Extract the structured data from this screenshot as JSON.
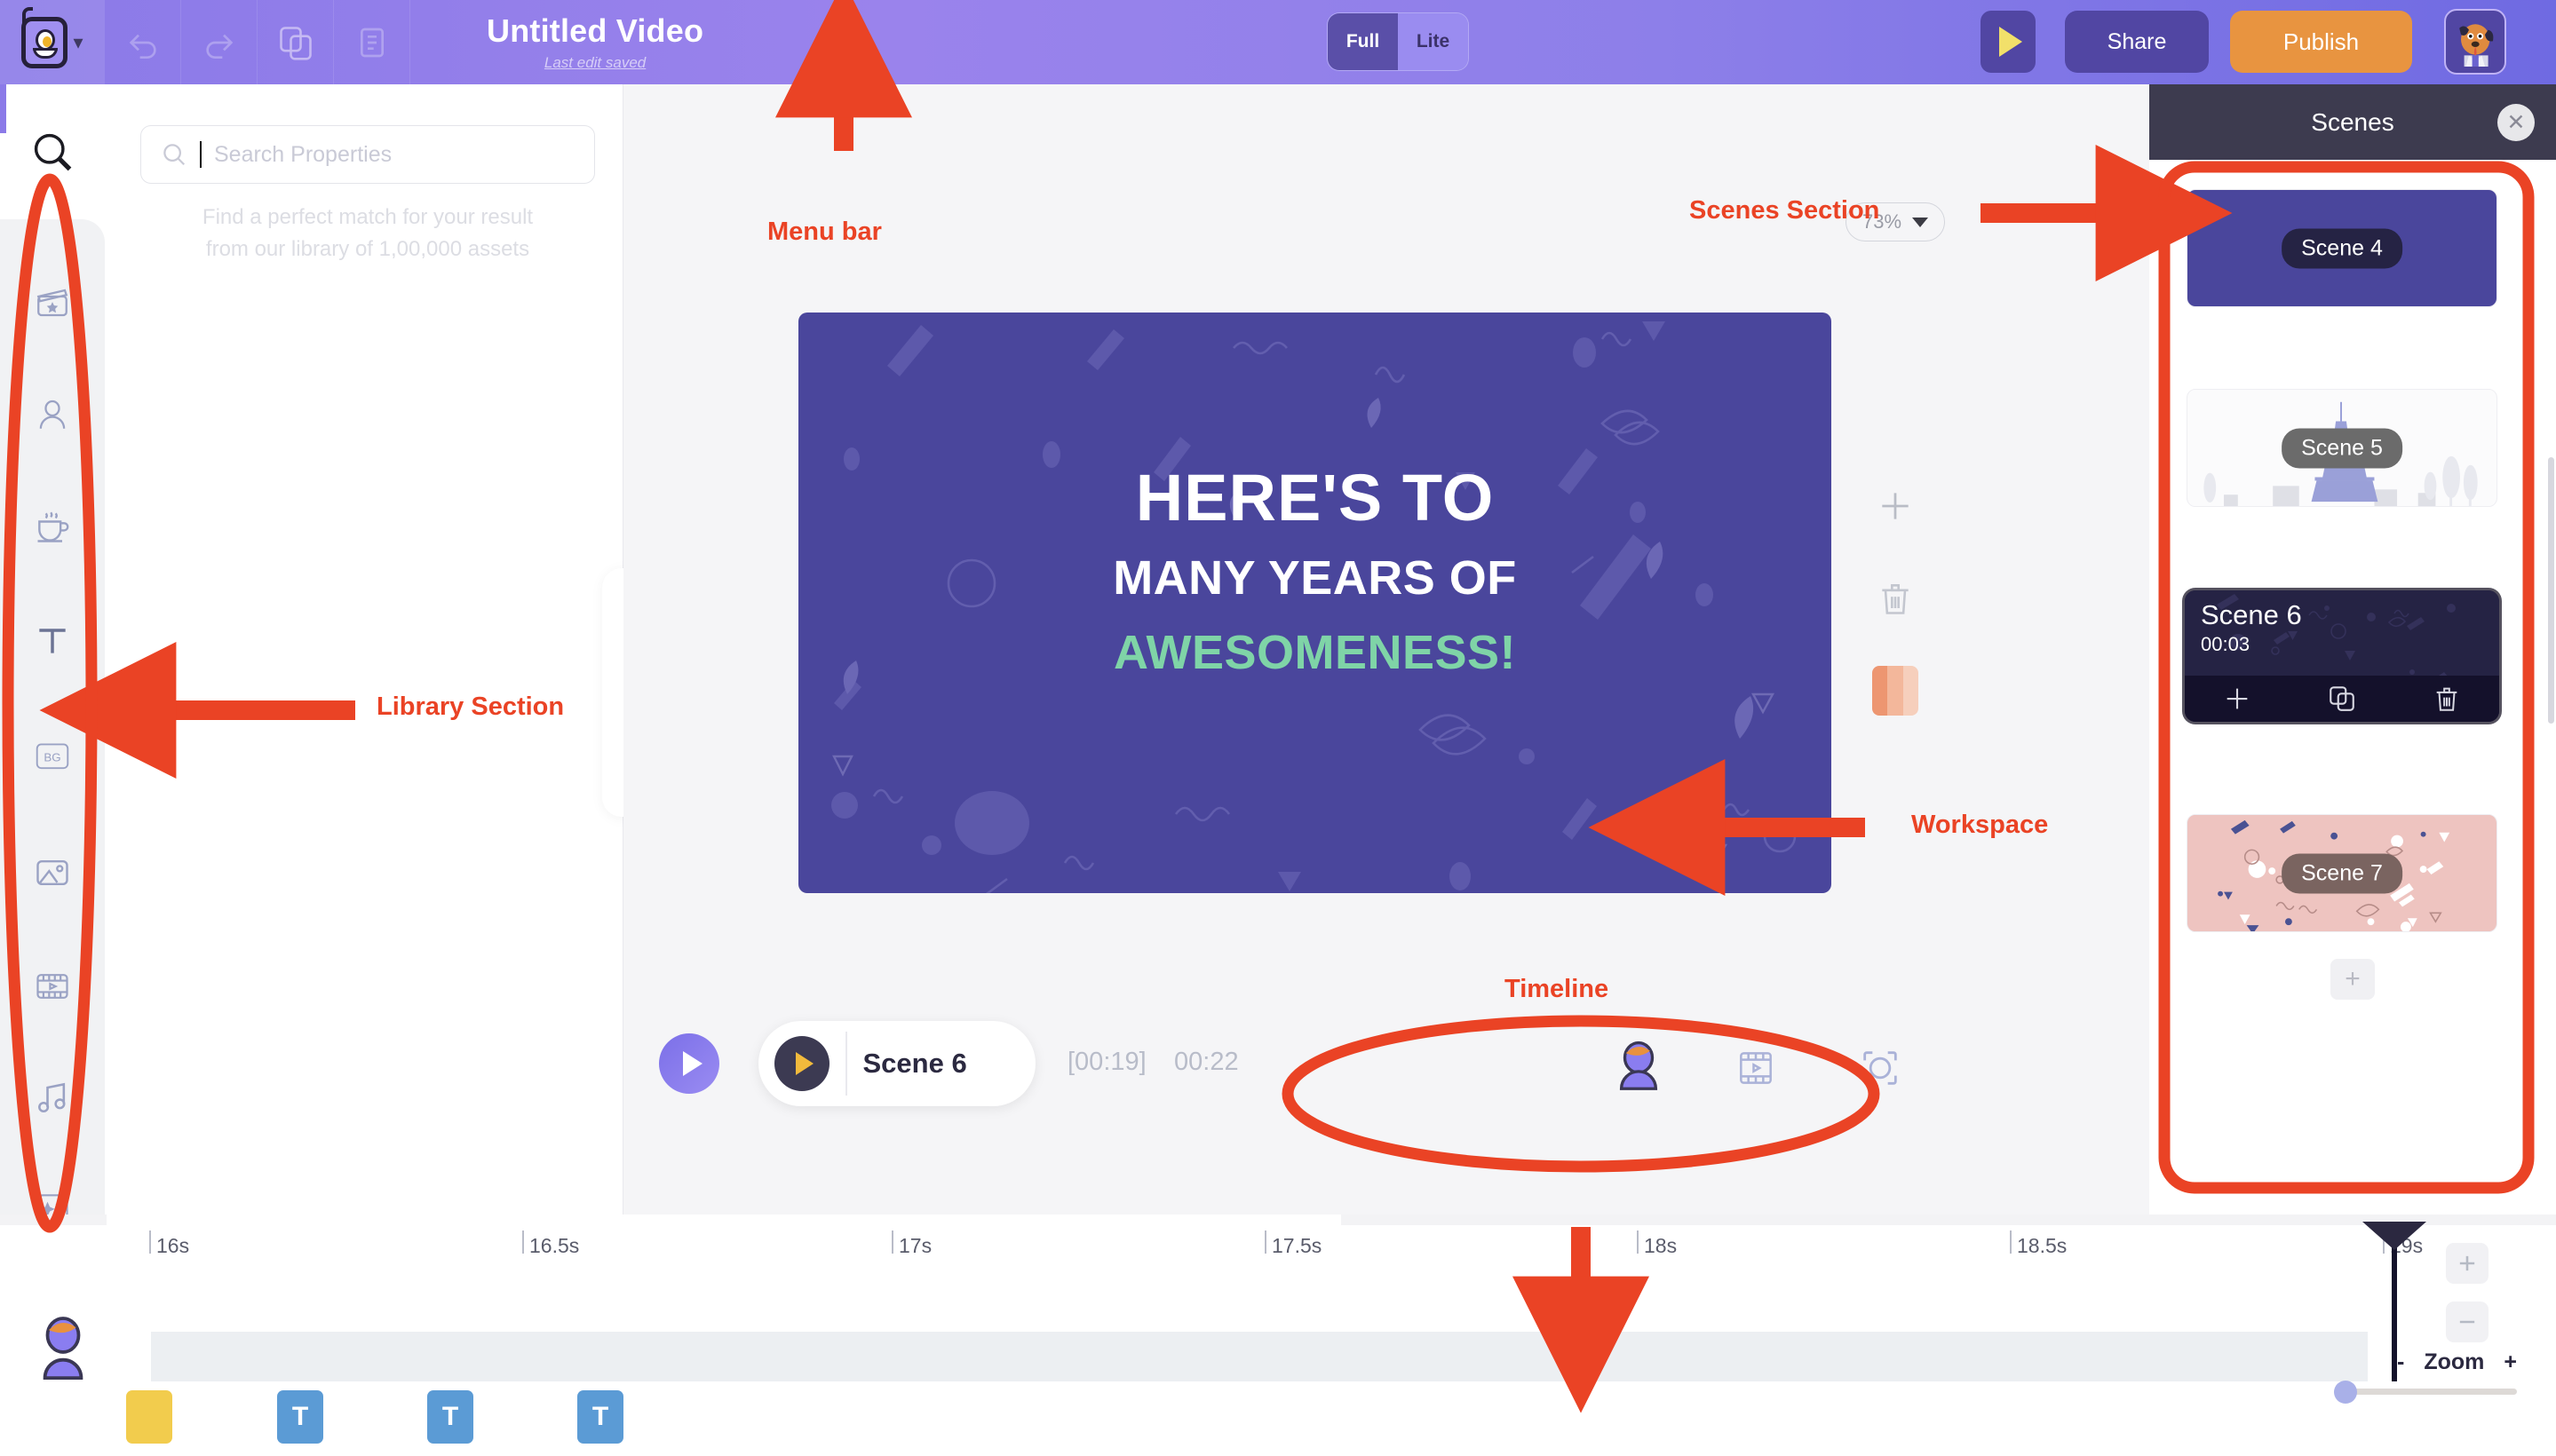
{
  "topbar": {
    "logo_icon": "robot-mascot-logo",
    "logo_chevron_icon": "chevron-down-icon",
    "tools": [
      {
        "icon": "undo-icon",
        "name": "undo-button"
      },
      {
        "icon": "redo-icon",
        "name": "redo-button"
      },
      {
        "icon": "copy-icon",
        "name": "copy-button"
      },
      {
        "icon": "notes-icon",
        "name": "notes-button"
      }
    ],
    "title": "Untitled Video",
    "subtitle": "Last edit saved",
    "mode_full": "Full",
    "mode_lite": "Lite",
    "preview_icon": "play-icon",
    "share_label": "Share",
    "publish_label": "Publish",
    "avatar_icon": "dog-avatar"
  },
  "rail": {
    "items": [
      {
        "name": "sidebar-item-search",
        "icon": "search-icon"
      },
      {
        "name": "sidebar-item-templates",
        "icon": "clapperboard-star-icon"
      },
      {
        "name": "sidebar-item-characters",
        "icon": "person-icon"
      },
      {
        "name": "sidebar-item-props",
        "icon": "coffee-cup-icon"
      },
      {
        "name": "sidebar-item-text",
        "icon": "text-t-icon"
      },
      {
        "name": "sidebar-item-background",
        "icon": "bg-icon",
        "label": "BG"
      },
      {
        "name": "sidebar-item-images",
        "icon": "image-icon"
      },
      {
        "name": "sidebar-item-video",
        "icon": "film-strip-icon"
      },
      {
        "name": "sidebar-item-music",
        "icon": "music-note-icon"
      },
      {
        "name": "sidebar-item-effects",
        "icon": "sparkle-icon"
      }
    ]
  },
  "library": {
    "search_placeholder": "Search Properties",
    "search_value": "",
    "search_icon": "search-icon",
    "hint_line1": "Find a perfect match for your result",
    "hint_line2": "from our library of 1,00,000 assets",
    "collapse_icon": "chevron-left-icon"
  },
  "canvas": {
    "zoom_level": "73%",
    "zoom_caret_icon": "caret-down-icon",
    "slide": {
      "line1": "HERE'S TO",
      "line2": "MANY YEARS OF",
      "line3": "AWESOMENESS!",
      "bg_color": "#4a469c",
      "accent_color": "#7fd4a7"
    },
    "tools": [
      {
        "name": "add-element-button",
        "icon": "plus-icon"
      },
      {
        "name": "delete-element-button",
        "icon": "trash-icon"
      },
      {
        "name": "color-swatch-button",
        "icon": "color-swatch-icon"
      }
    ]
  },
  "player": {
    "play_icon": "play-icon",
    "scene_play_icon": "play-icon",
    "scene_label": "Scene 6",
    "current_time": "[00:19]",
    "total_time": "00:22",
    "tools": [
      {
        "name": "character-tool",
        "icon": "person-avatar-icon"
      },
      {
        "name": "video-tool",
        "icon": "film-strip-icon"
      },
      {
        "name": "focus-tool",
        "icon": "focus-frame-icon"
      }
    ]
  },
  "scenes": {
    "title": "Scenes",
    "close_icon": "close-icon",
    "add_scene_icon": "plus-icon",
    "items": [
      {
        "label": "Scene 4",
        "type": "thumb",
        "bg": "#4a469c",
        "tag_bg": "#252344",
        "active": false
      },
      {
        "label": "Scene 5",
        "type": "thumb",
        "bg": "#fbfbfc",
        "tag_bg": "#6b6b6b",
        "active": false
      },
      {
        "label": "Scene 6",
        "duration": "00:03",
        "type": "active",
        "bg": "#252344",
        "active": true,
        "actions": [
          {
            "name": "add-scene-inline-button",
            "icon": "plus-icon"
          },
          {
            "name": "duplicate-scene-button",
            "icon": "copy-icon"
          },
          {
            "name": "delete-scene-button",
            "icon": "trash-icon"
          }
        ]
      },
      {
        "label": "Scene 7",
        "type": "thumb",
        "bg": "#eec4c0",
        "tag_bg": "#7a6460",
        "active": false
      }
    ]
  },
  "timeline": {
    "ticks": [
      "16s",
      "16.5s",
      "17s",
      "17.5s",
      "18s",
      "18.5s",
      "19s"
    ],
    "avatar_icon": "person-avatar-icon",
    "clips": [
      {
        "type": "asset",
        "label": "",
        "color": "#f2cc4d"
      },
      {
        "type": "text",
        "label": "T",
        "color": "#5b9bd5"
      },
      {
        "type": "text",
        "label": "T",
        "color": "#5b9bd5"
      },
      {
        "type": "text",
        "label": "T",
        "color": "#5b9bd5"
      }
    ],
    "zoom_in_icon": "plus-icon",
    "zoom_out_icon": "minus-icon",
    "zoom_minus": "-",
    "zoom_label": "Zoom",
    "zoom_plus": "+"
  },
  "annotations": {
    "accent_color": "#ea4325",
    "labels": [
      {
        "name": "annotation-menu-bar",
        "text": "Menu bar"
      },
      {
        "name": "annotation-library-section",
        "text": "Library Section"
      },
      {
        "name": "annotation-workspace",
        "text": "Workspace"
      },
      {
        "name": "annotation-scenes-section",
        "text": "Scenes Section"
      },
      {
        "name": "annotation-timeline",
        "text": "Timeline"
      }
    ]
  }
}
